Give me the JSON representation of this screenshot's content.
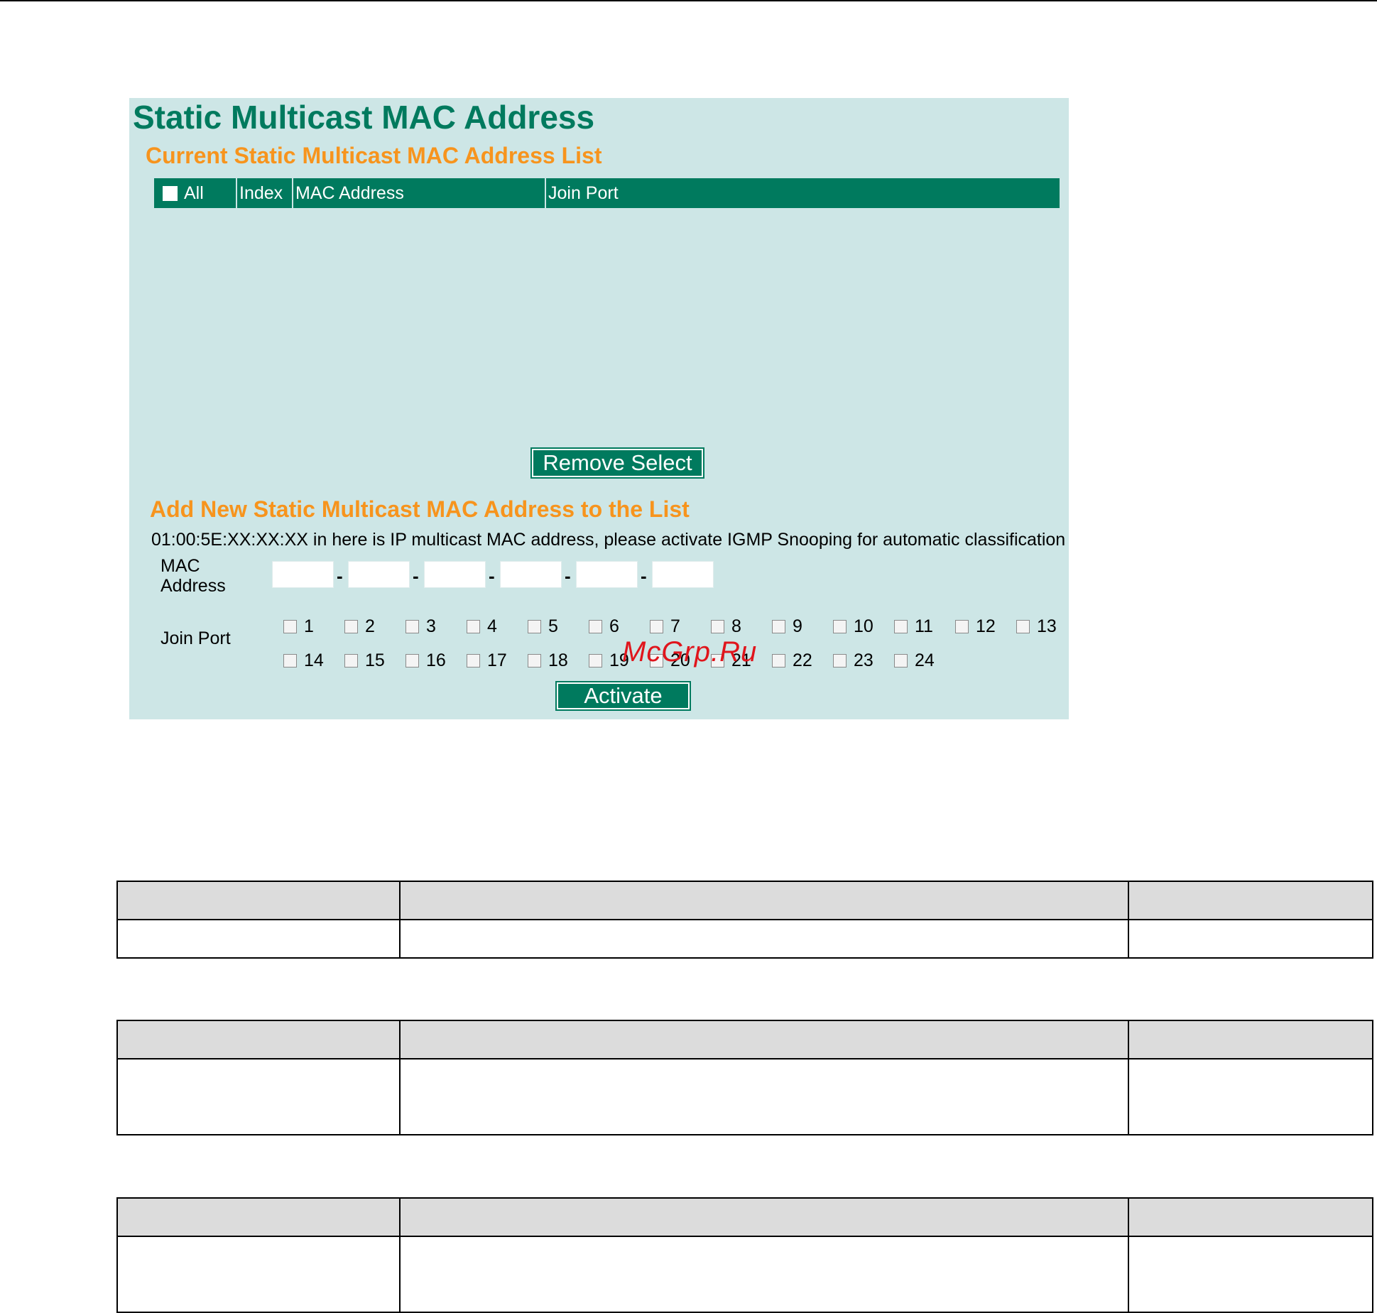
{
  "page": {
    "title": "Static Multicast MAC Address"
  },
  "current_list": {
    "section_title": "Current Static Multicast MAC Address List",
    "columns": {
      "all": "All",
      "index": "Index",
      "mac_address": "MAC Address",
      "join_port": "Join Port"
    },
    "rows": [],
    "remove_button": "Remove Select"
  },
  "add_new": {
    "section_title": "Add New Static Multicast MAC Address to the List",
    "note": "01:00:5E:XX:XX:XX in here is IP multicast MAC address, please activate IGMP Snooping for automatic classification",
    "mac_label_line1": "MAC",
    "mac_label_line2": "Address",
    "mac_fields": [
      "",
      "",
      "",
      "",
      "",
      ""
    ],
    "mac_separator": "-",
    "join_port_label": "Join Port",
    "ports": [
      "1",
      "2",
      "3",
      "4",
      "5",
      "6",
      "7",
      "8",
      "9",
      "10",
      "11",
      "12",
      "13",
      "14",
      "15",
      "16",
      "17",
      "18",
      "19",
      "20",
      "21",
      "22",
      "23",
      "24"
    ],
    "activate_button": "Activate"
  },
  "watermark": "McGrp.Ru",
  "colors": {
    "panel_bg": "#cde6e6",
    "accent_green": "#007a5e",
    "section_orange": "#f7941d",
    "watermark_red": "#e0151c",
    "table_header_gray": "#dcdcdc"
  }
}
